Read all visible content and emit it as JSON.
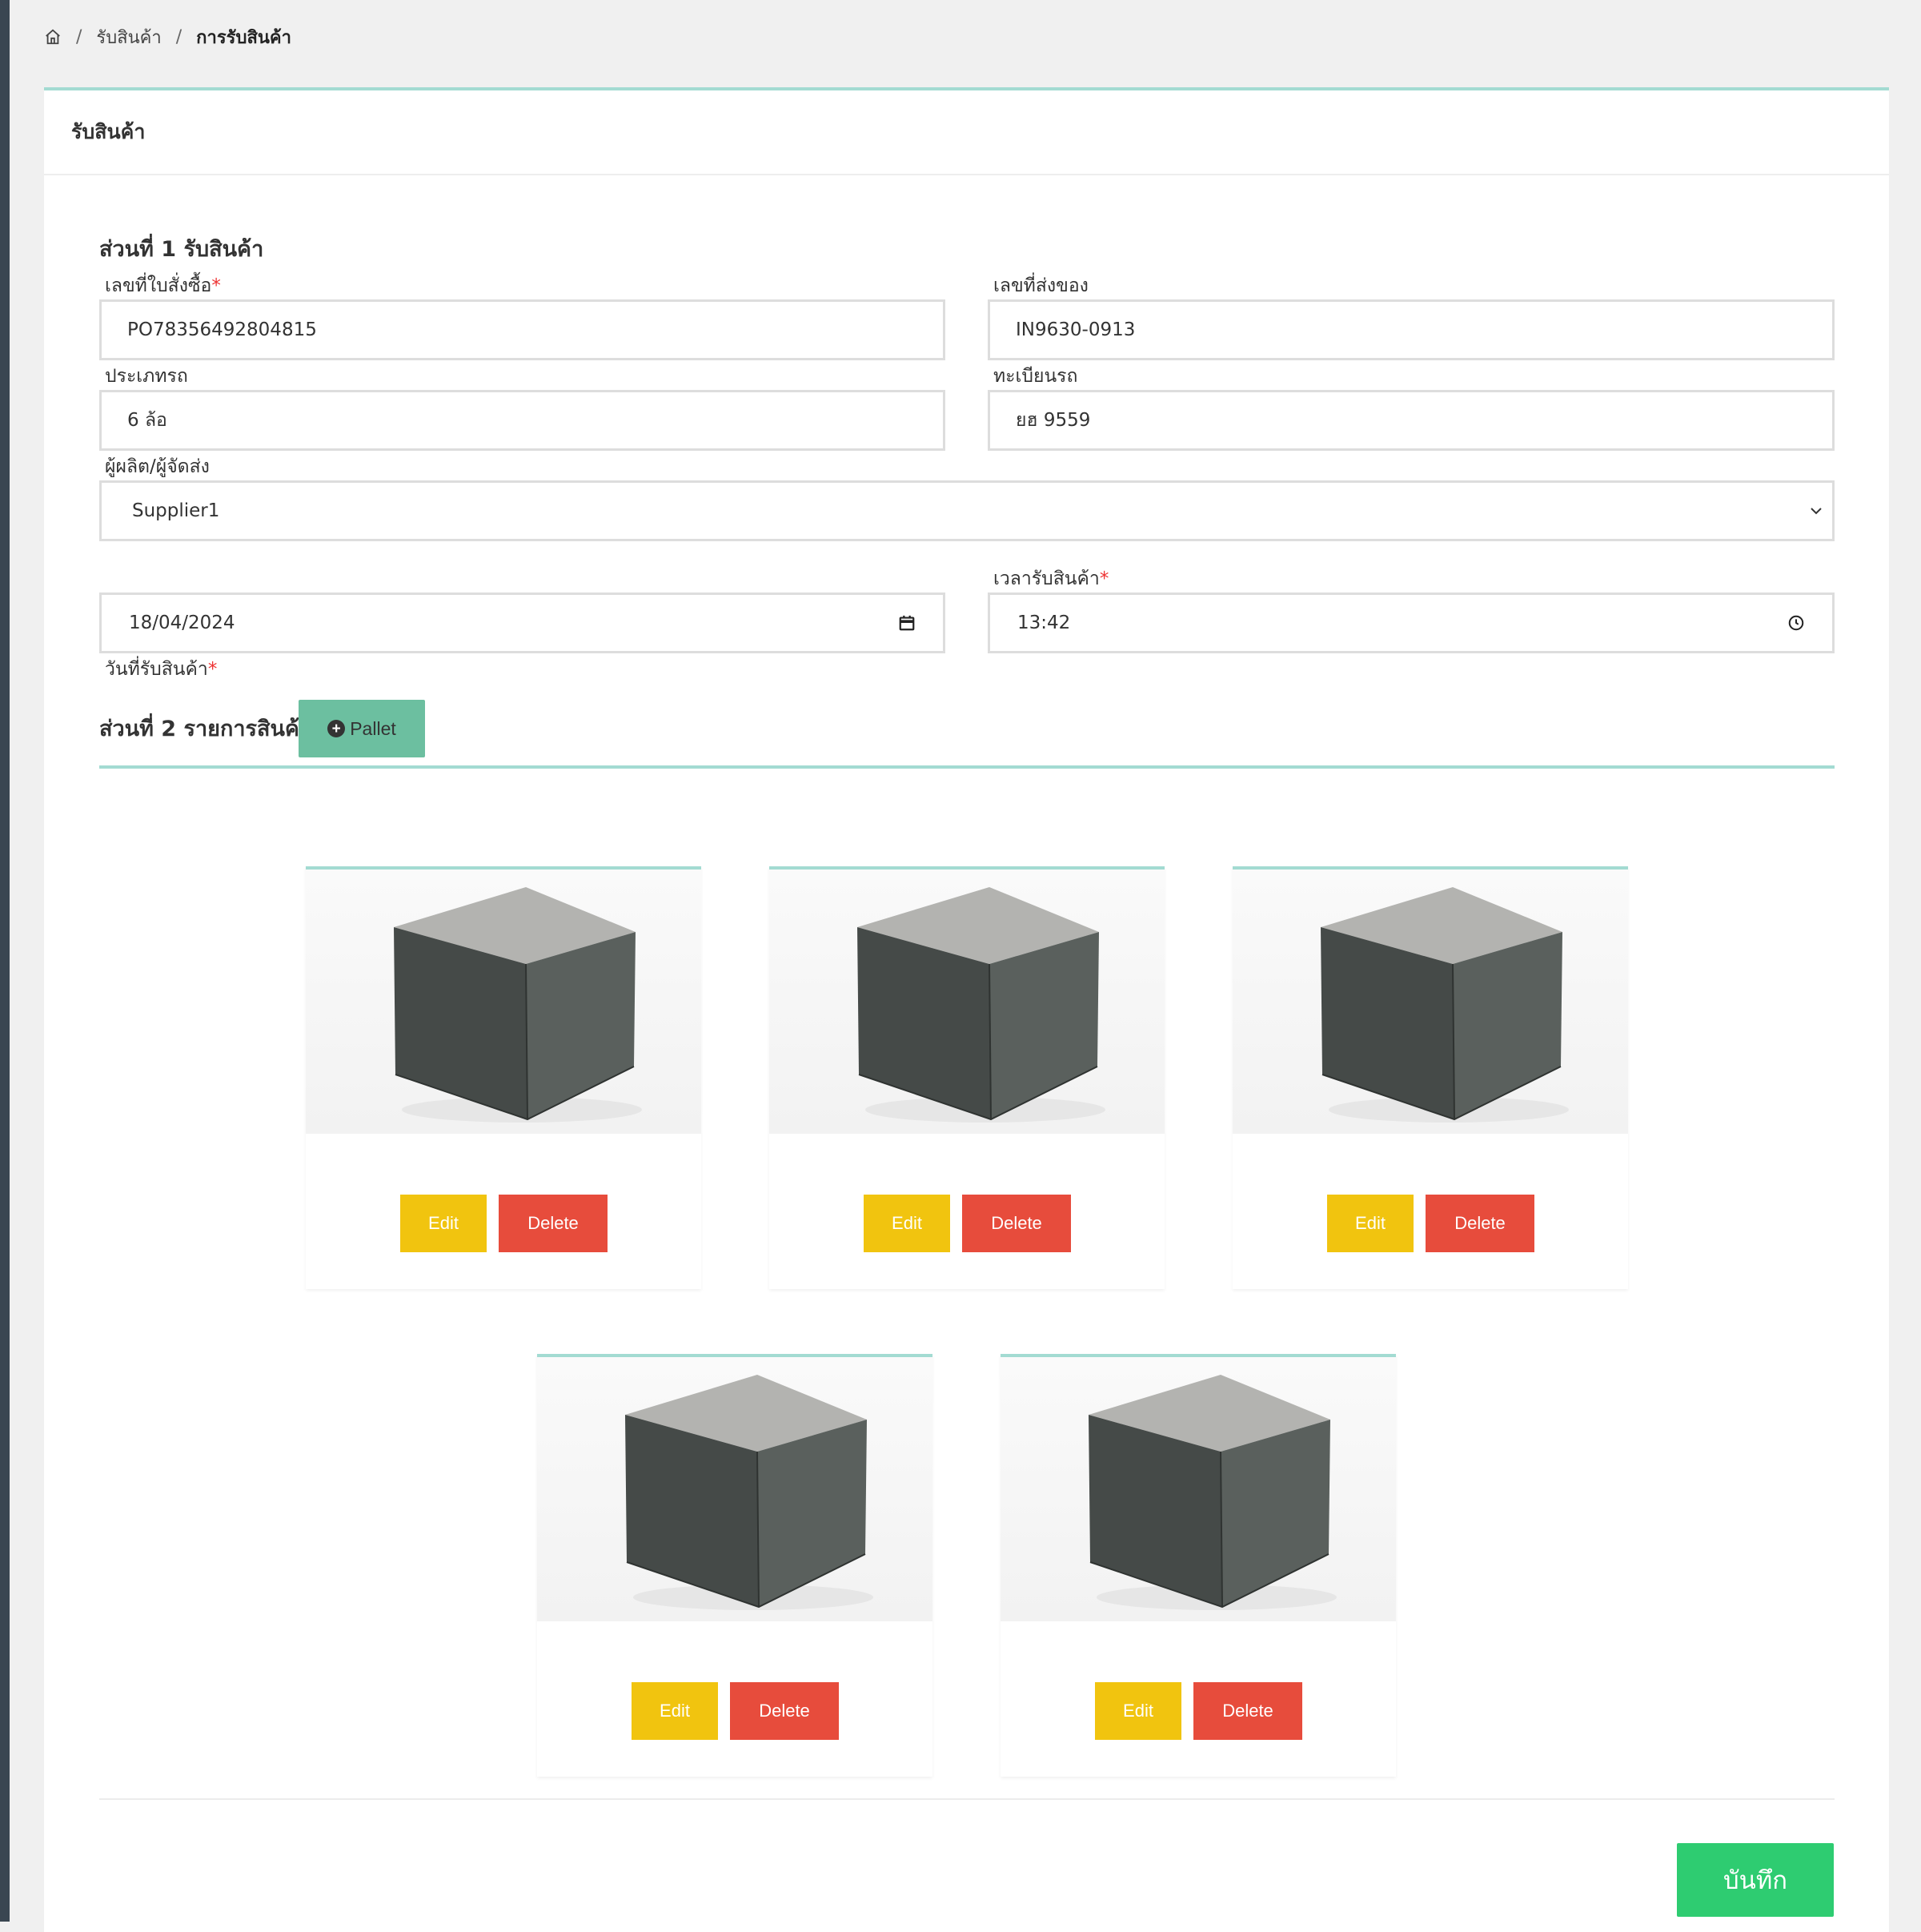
{
  "breadcrumb": {
    "items": [
      "รับสินค้า",
      "การรับสินค้า"
    ],
    "separator": "/"
  },
  "card": {
    "title": "รับสินค้า"
  },
  "section1": {
    "title": "ส่วนที่ 1 รับสินค้า",
    "fields": {
      "po_number": {
        "label": "เลขที่ใบสั่งซื้อ",
        "required_mark": "*",
        "value": "PO78356492804815"
      },
      "delivery_number": {
        "label": "เลขที่ส่งของ",
        "value": "IN9630-0913"
      },
      "vehicle_type": {
        "label": "ประเภทรถ",
        "value": "6 ล้อ"
      },
      "plate": {
        "label": "ทะเบียนรถ",
        "value": "ยฮ 9559"
      },
      "supplier": {
        "label": "ผู้ผลิต/ผู้จัดส่ง",
        "value": "Supplier1"
      },
      "receive_date": {
        "label": "วันที่รับสินค้า",
        "required_mark": "*",
        "value": "18/04/2024"
      },
      "receive_time": {
        "label": "เวลารับสินค้า",
        "required_mark": "*",
        "value": "13:42"
      }
    }
  },
  "section2": {
    "title": "ส่วนที่ 2 รายการสินค้า",
    "add_button_label": "Pallet",
    "items": [
      {
        "edit_label": "Edit",
        "delete_label": "Delete"
      },
      {
        "edit_label": "Edit",
        "delete_label": "Delete"
      },
      {
        "edit_label": "Edit",
        "delete_label": "Delete"
      },
      {
        "edit_label": "Edit",
        "delete_label": "Delete"
      },
      {
        "edit_label": "Edit",
        "delete_label": "Delete"
      }
    ]
  },
  "save_label": "บันทึก",
  "colors": {
    "accent_teal": "#a3dbd2",
    "pallet_button": "#6cbfa0",
    "edit_button": "#f1c40f",
    "delete_button": "#e74c3c",
    "save_button": "#2ecc71"
  },
  "icons": {
    "home": "home-icon",
    "add": "plus-circle-icon",
    "select": "chevron-down-icon",
    "date": "calendar-icon",
    "time": "clock-icon"
  }
}
